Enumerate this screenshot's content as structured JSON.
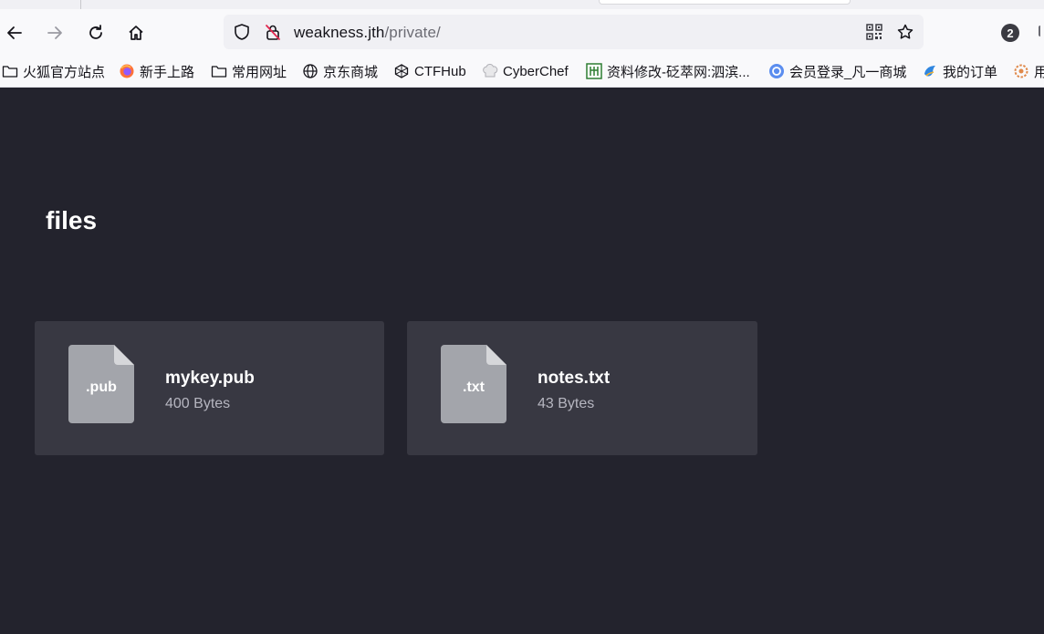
{
  "browser": {
    "url_host": "weakness.jth",
    "url_path": "/private/",
    "extension_badge": "2",
    "bookmarks": [
      {
        "label": "火狐官方站点",
        "icon": "folder-icon"
      },
      {
        "label": "新手上路",
        "icon": "firefox-icon"
      },
      {
        "label": "常用网址",
        "icon": "folder-icon"
      },
      {
        "label": "京东商城",
        "icon": "globe-icon"
      },
      {
        "label": "CTFHub",
        "icon": "ctfhub-icon"
      },
      {
        "label": "CyberChef",
        "icon": "chef-hat-icon"
      },
      {
        "label": "资料修改-砭萃网:泗滨...",
        "icon": "site-icon"
      },
      {
        "label": "会员登录_凡一商城",
        "icon": "shop-icon"
      },
      {
        "label": "我的订单",
        "icon": "order-icon"
      },
      {
        "label": "用",
        "icon": "gear-site-icon"
      }
    ]
  },
  "page": {
    "title": "files",
    "files": [
      {
        "ext": ".pub",
        "name": "mykey.pub",
        "size": "400 Bytes"
      },
      {
        "ext": ".txt",
        "name": "notes.txt",
        "size": "43 Bytes"
      }
    ]
  },
  "colors": {
    "page_bg": "#23232d",
    "card_bg": "#383842",
    "file_icon": "#a3a5ab",
    "file_fold": "#d6d7da"
  }
}
